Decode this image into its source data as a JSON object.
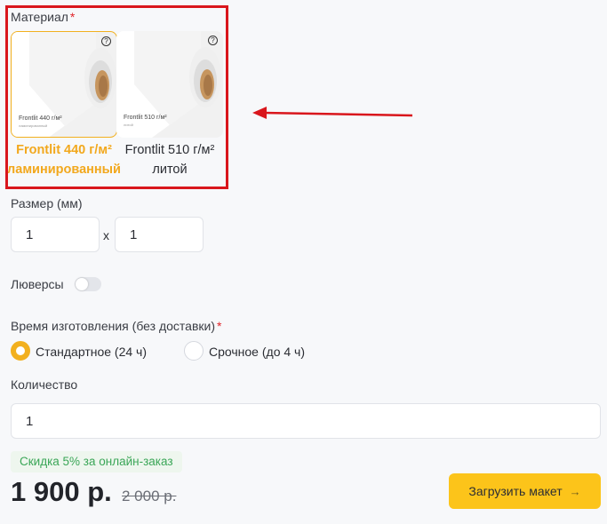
{
  "material": {
    "label": "Материал",
    "required_mark": "*",
    "options": [
      {
        "roll_text": "Frontlit 440 г/м²",
        "roll_subtext": "ламинированный",
        "help": "?",
        "caption_line1": "Frontlit 440 г/м²",
        "caption_line2": "ламинированный",
        "selected": true
      },
      {
        "roll_text": "Frontlit 510 г/м²",
        "roll_subtext": "литой",
        "help": "?",
        "caption_line1": "Frontlit 510 г/м²",
        "caption_line2": "литой",
        "selected": false
      }
    ]
  },
  "size": {
    "label": "Размер (мм)",
    "width": "1",
    "height": "1",
    "separator": "x"
  },
  "grommets": {
    "label": "Люверсы",
    "enabled": false
  },
  "production_time": {
    "label": "Время изготовления (без доставки)",
    "required_mark": "*",
    "options": [
      {
        "label": "Стандартное (24 ч)",
        "selected": true
      },
      {
        "label": "Срочное (до 4 ч)",
        "selected": false
      }
    ]
  },
  "quantity": {
    "label": "Количество",
    "value": "1"
  },
  "discount_text": "Скидка 5% за онлайн-заказ",
  "price": "1 900 р.",
  "old_price": "2 000 р.",
  "upload_button": {
    "label": "Загрузить макет",
    "icon": "arrow-right-icon"
  },
  "colors": {
    "accent": "#f2b01e",
    "button": "#fcc41a",
    "annotation": "#d9161c",
    "discount": "#3aa657"
  }
}
